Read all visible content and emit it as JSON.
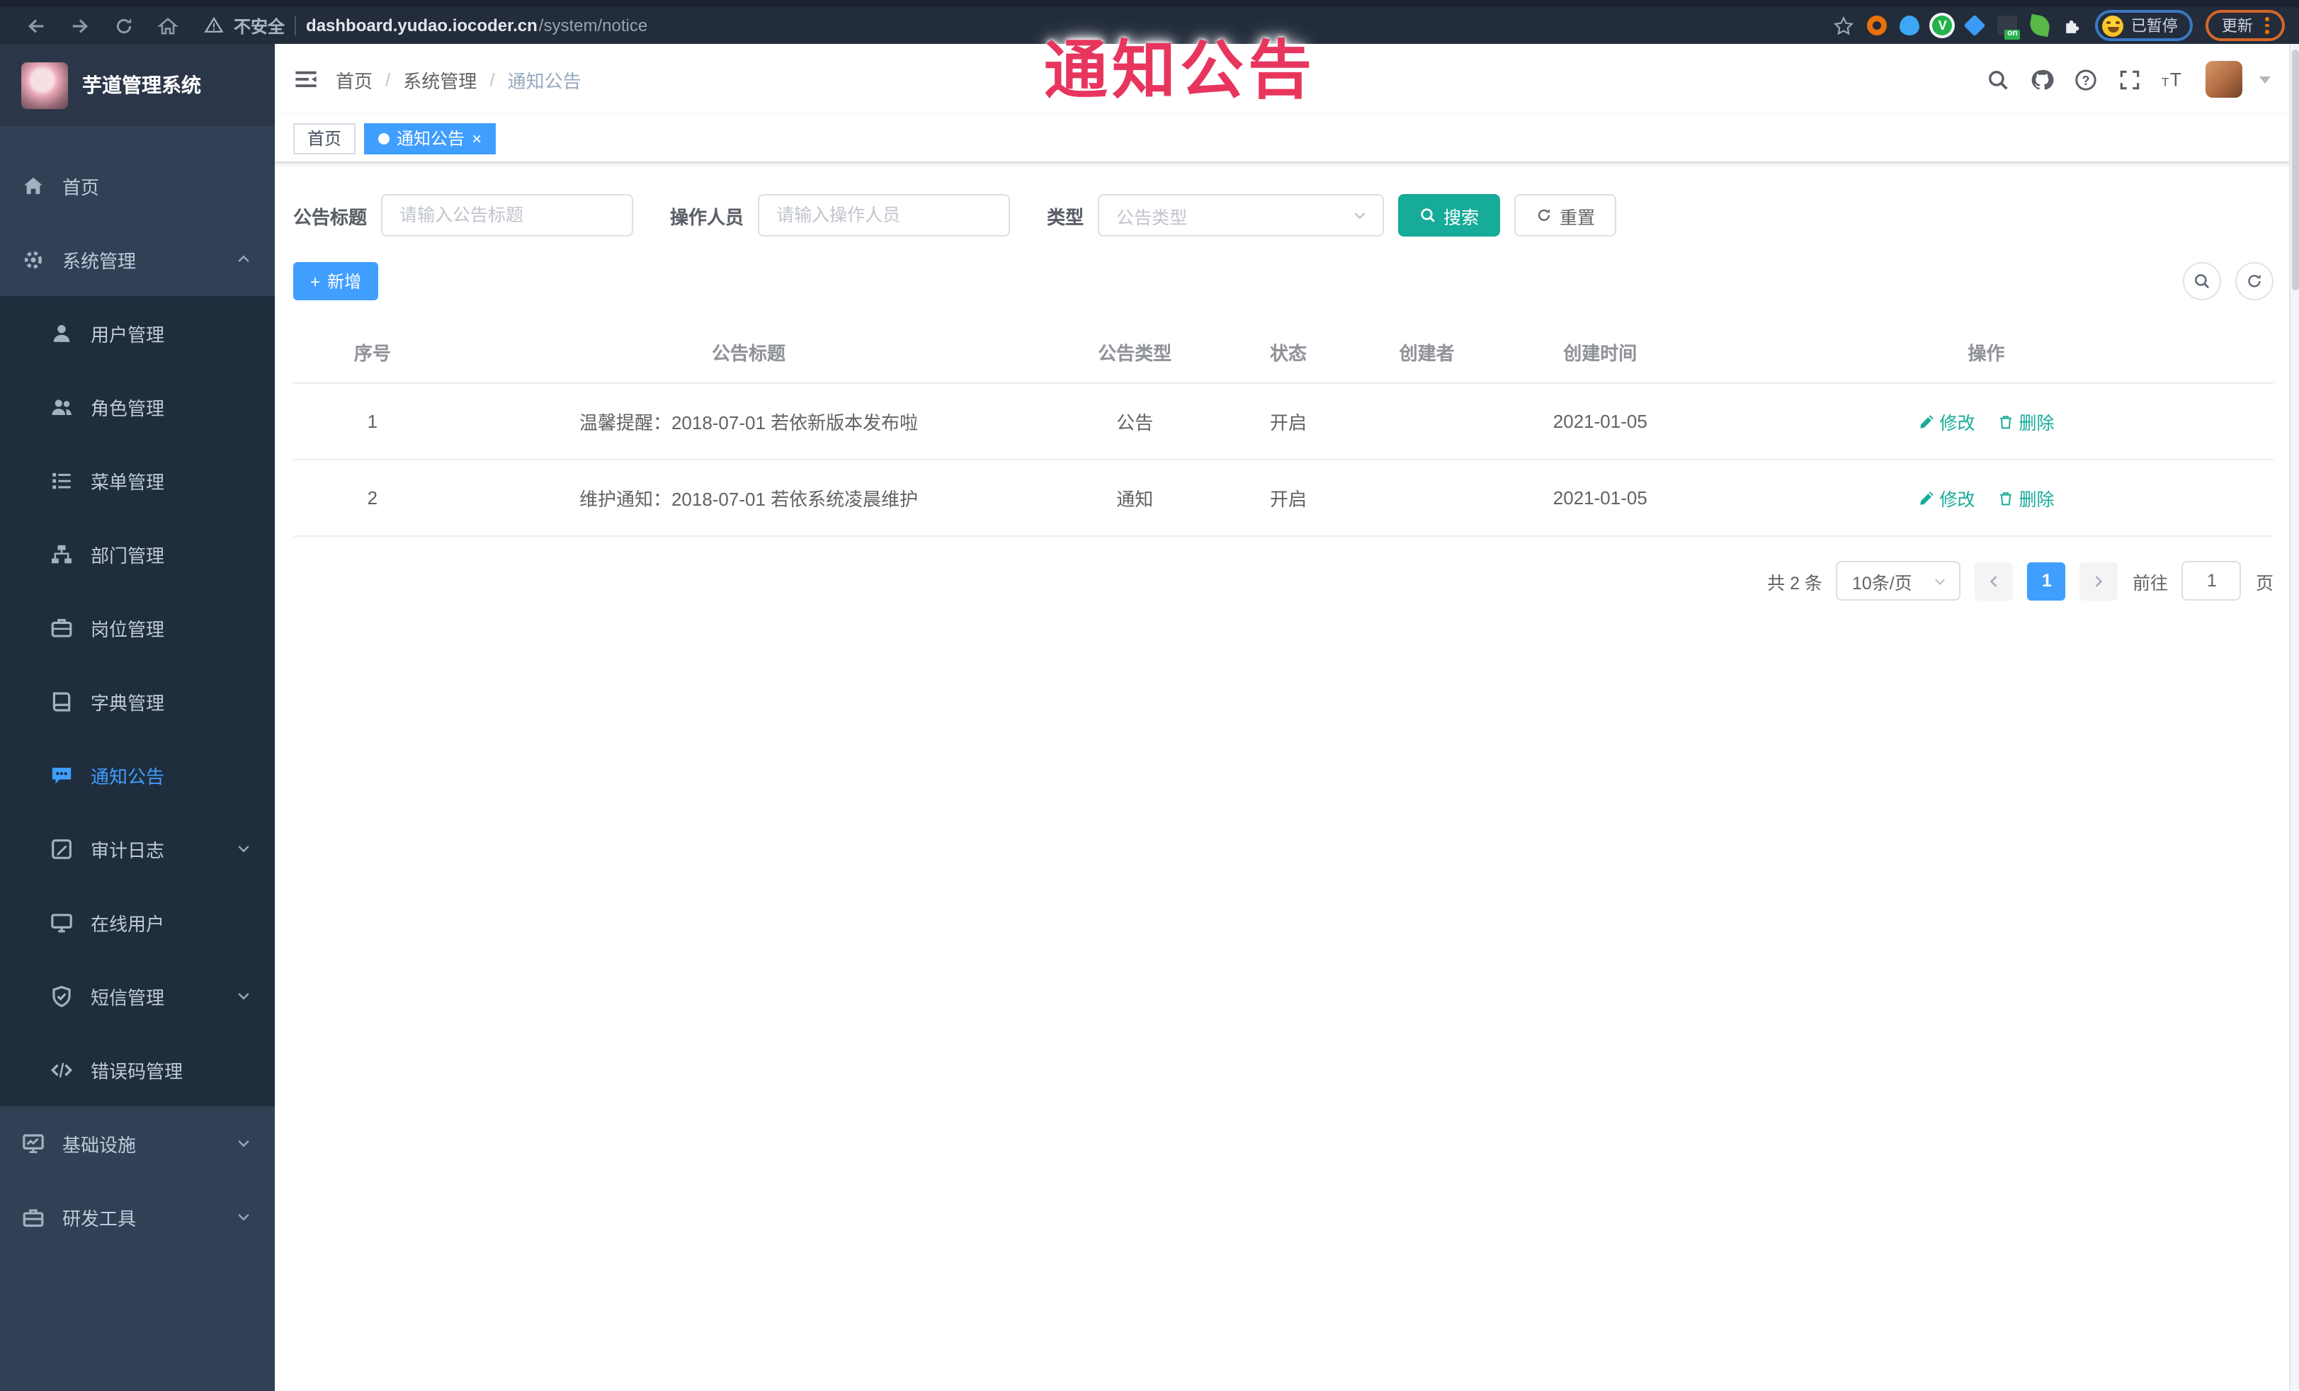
{
  "colors": {
    "primary": "#409EFF",
    "teal": "#17ab99",
    "watermark_red": "#e8355e",
    "sidebar_bg": "#304156",
    "submenu_bg": "#1f2d3d",
    "active_tab": "#409EFF"
  },
  "watermark_text": "通知公告",
  "browser": {
    "security_label": "不安全",
    "url_host": "dashboard.yudao.iocoder.cn",
    "url_path": "/system/notice",
    "paused_label": "已暂停",
    "update_label": "更新"
  },
  "sidebar": {
    "title": "芋道管理系统",
    "menu": [
      {
        "id": "home",
        "label": "首页",
        "icon": "home-icon"
      },
      {
        "id": "system",
        "label": "系统管理",
        "icon": "gear-icon",
        "arrow": "up",
        "children": [
          {
            "id": "user",
            "label": "用户管理",
            "icon": "user-icon"
          },
          {
            "id": "role",
            "label": "角色管理",
            "icon": "users-icon"
          },
          {
            "id": "menu",
            "label": "菜单管理",
            "icon": "menu-icon"
          },
          {
            "id": "dept",
            "label": "部门管理",
            "icon": "tree-icon"
          },
          {
            "id": "post",
            "label": "岗位管理",
            "icon": "post-icon"
          },
          {
            "id": "dict",
            "label": "字典管理",
            "icon": "dict-icon"
          },
          {
            "id": "notice",
            "label": "通知公告",
            "icon": "notice-icon",
            "active": true
          },
          {
            "id": "audit-log",
            "label": "审计日志",
            "icon": "log-icon",
            "arrow": "down"
          },
          {
            "id": "online-user",
            "label": "在线用户",
            "icon": "online-icon"
          },
          {
            "id": "sms",
            "label": "短信管理",
            "icon": "sms-icon",
            "arrow": "down"
          },
          {
            "id": "error-code",
            "label": "错误码管理",
            "icon": "code-icon"
          }
        ]
      },
      {
        "id": "infra",
        "label": "基础设施",
        "icon": "infra-icon",
        "arrow": "down"
      },
      {
        "id": "dev-tools",
        "label": "研发工具",
        "icon": "tools-icon",
        "arrow": "down"
      }
    ]
  },
  "header": {
    "breadcrumb": [
      "首页",
      "系统管理",
      "通知公告"
    ]
  },
  "tabs": [
    {
      "label": "首页"
    },
    {
      "label": "通知公告"
    }
  ],
  "filters": {
    "title_label": "公告标题",
    "title_placeholder": "请输入公告标题",
    "operator_label": "操作人员",
    "operator_placeholder": "请输入操作人员",
    "type_label": "类型",
    "type_placeholder": "公告类型",
    "search_label": "搜索",
    "reset_label": "重置"
  },
  "toolbar": {
    "add_label": "新增"
  },
  "table": {
    "headers": [
      "序号",
      "公告标题",
      "公告类型",
      "状态",
      "创建者",
      "创建时间",
      "操作"
    ],
    "rows": [
      {
        "no": "1",
        "title": "温馨提醒：2018-07-01 若依新版本发布啦",
        "type": "公告",
        "status": "开启",
        "creator": "",
        "created": "2021-01-05"
      },
      {
        "no": "2",
        "title": "维护通知：2018-07-01 若依系统凌晨维护",
        "type": "通知",
        "status": "开启",
        "creator": "",
        "created": "2021-01-05"
      }
    ],
    "edit_label": "修改",
    "delete_label": "删除"
  },
  "pagination": {
    "total": "共 2 条",
    "page_size": "10条/页",
    "current": "1",
    "goto_label": "前往",
    "goto_value": "1",
    "page_suffix": "页"
  }
}
